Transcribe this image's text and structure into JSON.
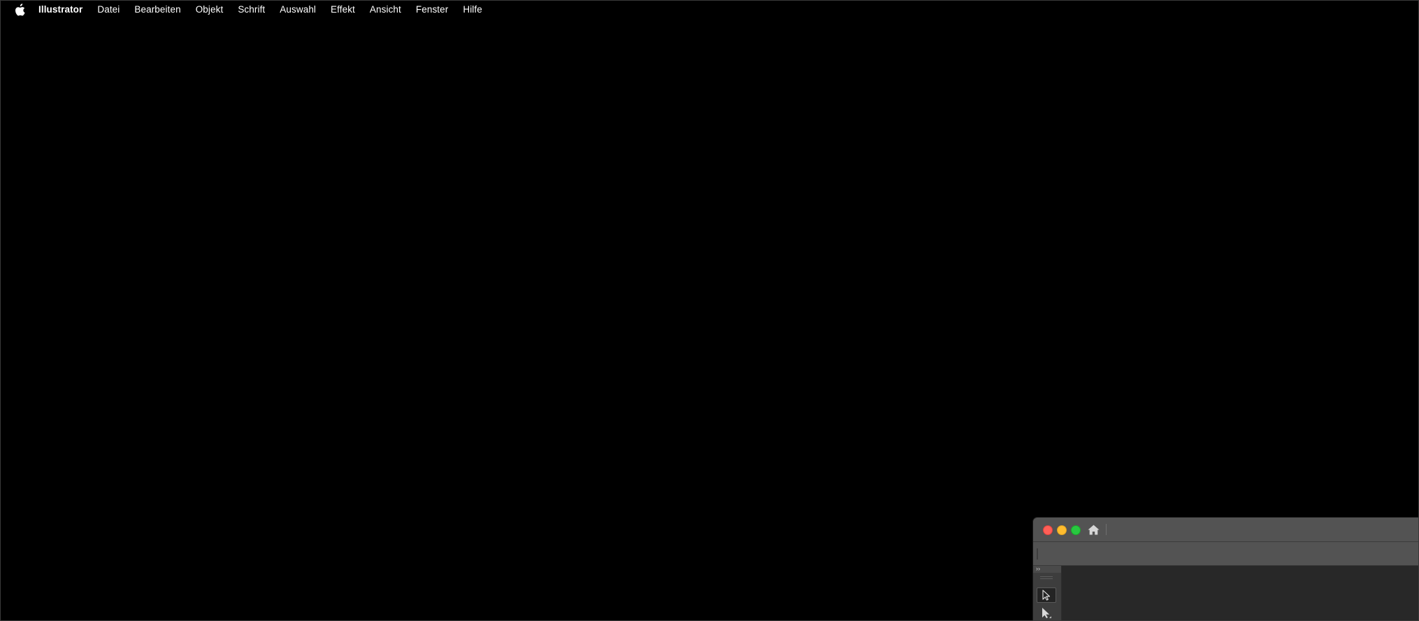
{
  "menubar": {
    "apple_icon": "apple-logo-icon",
    "app_name": "Illustrator",
    "items": [
      "Datei",
      "Bearbeiten",
      "Objekt",
      "Schrift",
      "Auswahl",
      "Effekt",
      "Ansicht",
      "Fenster",
      "Hilfe"
    ]
  },
  "window": {
    "traffic_lights": {
      "close_color": "#ff5f57",
      "minimize_color": "#febc2e",
      "maximize_color": "#28c840"
    },
    "home_icon": "home-icon",
    "toolbar": {
      "collapse_label": "››",
      "tools": [
        "selection-tool-icon",
        "direct-selection-tool-icon"
      ]
    }
  }
}
